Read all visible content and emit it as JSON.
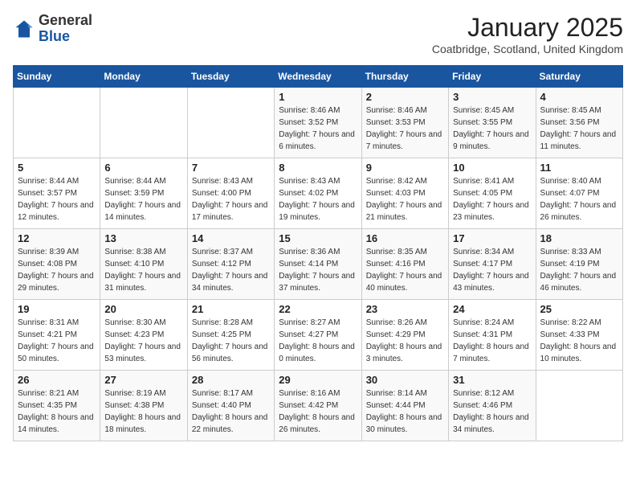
{
  "header": {
    "logo_general": "General",
    "logo_blue": "Blue",
    "month": "January 2025",
    "location": "Coatbridge, Scotland, United Kingdom"
  },
  "weekdays": [
    "Sunday",
    "Monday",
    "Tuesday",
    "Wednesday",
    "Thursday",
    "Friday",
    "Saturday"
  ],
  "weeks": [
    [
      {
        "day": "",
        "sunrise": "",
        "sunset": "",
        "daylight": ""
      },
      {
        "day": "",
        "sunrise": "",
        "sunset": "",
        "daylight": ""
      },
      {
        "day": "",
        "sunrise": "",
        "sunset": "",
        "daylight": ""
      },
      {
        "day": "1",
        "sunrise": "Sunrise: 8:46 AM",
        "sunset": "Sunset: 3:52 PM",
        "daylight": "Daylight: 7 hours and 6 minutes."
      },
      {
        "day": "2",
        "sunrise": "Sunrise: 8:46 AM",
        "sunset": "Sunset: 3:53 PM",
        "daylight": "Daylight: 7 hours and 7 minutes."
      },
      {
        "day": "3",
        "sunrise": "Sunrise: 8:45 AM",
        "sunset": "Sunset: 3:55 PM",
        "daylight": "Daylight: 7 hours and 9 minutes."
      },
      {
        "day": "4",
        "sunrise": "Sunrise: 8:45 AM",
        "sunset": "Sunset: 3:56 PM",
        "daylight": "Daylight: 7 hours and 11 minutes."
      }
    ],
    [
      {
        "day": "5",
        "sunrise": "Sunrise: 8:44 AM",
        "sunset": "Sunset: 3:57 PM",
        "daylight": "Daylight: 7 hours and 12 minutes."
      },
      {
        "day": "6",
        "sunrise": "Sunrise: 8:44 AM",
        "sunset": "Sunset: 3:59 PM",
        "daylight": "Daylight: 7 hours and 14 minutes."
      },
      {
        "day": "7",
        "sunrise": "Sunrise: 8:43 AM",
        "sunset": "Sunset: 4:00 PM",
        "daylight": "Daylight: 7 hours and 17 minutes."
      },
      {
        "day": "8",
        "sunrise": "Sunrise: 8:43 AM",
        "sunset": "Sunset: 4:02 PM",
        "daylight": "Daylight: 7 hours and 19 minutes."
      },
      {
        "day": "9",
        "sunrise": "Sunrise: 8:42 AM",
        "sunset": "Sunset: 4:03 PM",
        "daylight": "Daylight: 7 hours and 21 minutes."
      },
      {
        "day": "10",
        "sunrise": "Sunrise: 8:41 AM",
        "sunset": "Sunset: 4:05 PM",
        "daylight": "Daylight: 7 hours and 23 minutes."
      },
      {
        "day": "11",
        "sunrise": "Sunrise: 8:40 AM",
        "sunset": "Sunset: 4:07 PM",
        "daylight": "Daylight: 7 hours and 26 minutes."
      }
    ],
    [
      {
        "day": "12",
        "sunrise": "Sunrise: 8:39 AM",
        "sunset": "Sunset: 4:08 PM",
        "daylight": "Daylight: 7 hours and 29 minutes."
      },
      {
        "day": "13",
        "sunrise": "Sunrise: 8:38 AM",
        "sunset": "Sunset: 4:10 PM",
        "daylight": "Daylight: 7 hours and 31 minutes."
      },
      {
        "day": "14",
        "sunrise": "Sunrise: 8:37 AM",
        "sunset": "Sunset: 4:12 PM",
        "daylight": "Daylight: 7 hours and 34 minutes."
      },
      {
        "day": "15",
        "sunrise": "Sunrise: 8:36 AM",
        "sunset": "Sunset: 4:14 PM",
        "daylight": "Daylight: 7 hours and 37 minutes."
      },
      {
        "day": "16",
        "sunrise": "Sunrise: 8:35 AM",
        "sunset": "Sunset: 4:16 PM",
        "daylight": "Daylight: 7 hours and 40 minutes."
      },
      {
        "day": "17",
        "sunrise": "Sunrise: 8:34 AM",
        "sunset": "Sunset: 4:17 PM",
        "daylight": "Daylight: 7 hours and 43 minutes."
      },
      {
        "day": "18",
        "sunrise": "Sunrise: 8:33 AM",
        "sunset": "Sunset: 4:19 PM",
        "daylight": "Daylight: 7 hours and 46 minutes."
      }
    ],
    [
      {
        "day": "19",
        "sunrise": "Sunrise: 8:31 AM",
        "sunset": "Sunset: 4:21 PM",
        "daylight": "Daylight: 7 hours and 50 minutes."
      },
      {
        "day": "20",
        "sunrise": "Sunrise: 8:30 AM",
        "sunset": "Sunset: 4:23 PM",
        "daylight": "Daylight: 7 hours and 53 minutes."
      },
      {
        "day": "21",
        "sunrise": "Sunrise: 8:28 AM",
        "sunset": "Sunset: 4:25 PM",
        "daylight": "Daylight: 7 hours and 56 minutes."
      },
      {
        "day": "22",
        "sunrise": "Sunrise: 8:27 AM",
        "sunset": "Sunset: 4:27 PM",
        "daylight": "Daylight: 8 hours and 0 minutes."
      },
      {
        "day": "23",
        "sunrise": "Sunrise: 8:26 AM",
        "sunset": "Sunset: 4:29 PM",
        "daylight": "Daylight: 8 hours and 3 minutes."
      },
      {
        "day": "24",
        "sunrise": "Sunrise: 8:24 AM",
        "sunset": "Sunset: 4:31 PM",
        "daylight": "Daylight: 8 hours and 7 minutes."
      },
      {
        "day": "25",
        "sunrise": "Sunrise: 8:22 AM",
        "sunset": "Sunset: 4:33 PM",
        "daylight": "Daylight: 8 hours and 10 minutes."
      }
    ],
    [
      {
        "day": "26",
        "sunrise": "Sunrise: 8:21 AM",
        "sunset": "Sunset: 4:35 PM",
        "daylight": "Daylight: 8 hours and 14 minutes."
      },
      {
        "day": "27",
        "sunrise": "Sunrise: 8:19 AM",
        "sunset": "Sunset: 4:38 PM",
        "daylight": "Daylight: 8 hours and 18 minutes."
      },
      {
        "day": "28",
        "sunrise": "Sunrise: 8:17 AM",
        "sunset": "Sunset: 4:40 PM",
        "daylight": "Daylight: 8 hours and 22 minutes."
      },
      {
        "day": "29",
        "sunrise": "Sunrise: 8:16 AM",
        "sunset": "Sunset: 4:42 PM",
        "daylight": "Daylight: 8 hours and 26 minutes."
      },
      {
        "day": "30",
        "sunrise": "Sunrise: 8:14 AM",
        "sunset": "Sunset: 4:44 PM",
        "daylight": "Daylight: 8 hours and 30 minutes."
      },
      {
        "day": "31",
        "sunrise": "Sunrise: 8:12 AM",
        "sunset": "Sunset: 4:46 PM",
        "daylight": "Daylight: 8 hours and 34 minutes."
      },
      {
        "day": "",
        "sunrise": "",
        "sunset": "",
        "daylight": ""
      }
    ]
  ]
}
